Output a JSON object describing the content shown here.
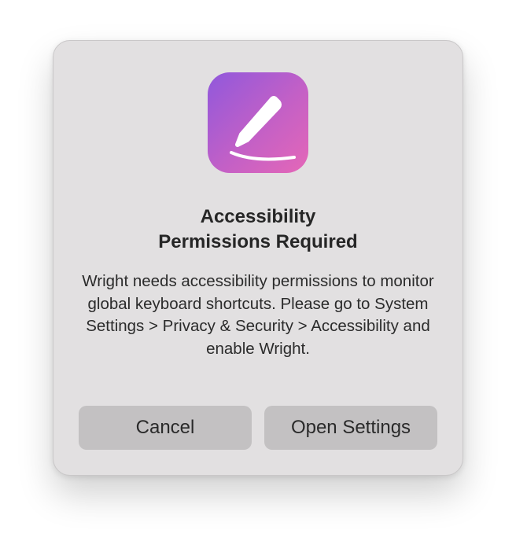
{
  "dialog": {
    "app_icon": "pencil-stroke-icon",
    "title_line1": "Accessibility",
    "title_line2": "Permissions Required",
    "message": "Wright needs accessibility permissions to monitor global keyboard shortcuts. Please go to System Settings > Privacy & Security > Accessibility and enable Wright.",
    "cancel_label": "Cancel",
    "open_settings_label": "Open Settings"
  },
  "colors": {
    "dialog_bg": "#e2e0e1",
    "button_bg": "#c3c1c2",
    "icon_gradient_start": "#9058dc",
    "icon_gradient_end": "#e567b7"
  }
}
